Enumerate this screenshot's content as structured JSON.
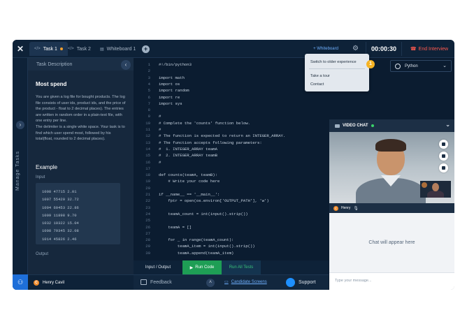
{
  "header": {
    "tabs": [
      {
        "label": "Task 1"
      },
      {
        "label": "Task 2"
      },
      {
        "label": "Whiteboard 1"
      }
    ],
    "whiteboard_label": "+ Whiteboard",
    "timer": "00:00:30",
    "end_label": "End Interview"
  },
  "sidebar": {
    "label": "Manage Tasks"
  },
  "task": {
    "header": "Task Description",
    "title": "Most spend",
    "body": "You are given a log file for bought products. The log file consists of user ids, product ids, and the price of the product - float to 2 decimal places). The entries are written in random order in a plain-text file, with one entry per line.\nThe delimiter is a single white space. Your task is to find which user spend most, followed by his total(float, rounded to 2 decimal places).",
    "example_title": "Example",
    "input_label": "Input",
    "input_lines": [
      "1008 47715 2.01",
      "1007 55420 32.72",
      "1004 60453 22.86",
      "1009 11898 9.70",
      "1032 10322 15.04",
      "1008 79345 32.08",
      "1014 45826 2.46"
    ],
    "output_label": "Output"
  },
  "candidate": {
    "initial": "C",
    "name": "Henry Cavil"
  },
  "editor": {
    "lines": [
      {
        "n": "1",
        "t": "#!/bin/python3"
      },
      {
        "n": "2",
        "t": ""
      },
      {
        "n": "3",
        "t": "import math"
      },
      {
        "n": "4",
        "t": "import os"
      },
      {
        "n": "5",
        "t": "import random"
      },
      {
        "n": "6",
        "t": "import re"
      },
      {
        "n": "7",
        "t": "import sys"
      },
      {
        "n": "8",
        "t": ""
      },
      {
        "n": "9",
        "t": "#"
      },
      {
        "n": "10",
        "t": "# Complete the 'counts' function below."
      },
      {
        "n": "11",
        "t": "#"
      },
      {
        "n": "12",
        "t": "# The function is expected to return an INTEGER_ARRAY."
      },
      {
        "n": "13",
        "t": "# The function accepts following parameters:"
      },
      {
        "n": "14",
        "t": "#  1. INTEGER_ARRAY teamA"
      },
      {
        "n": "15",
        "t": "#  2. INTEGER_ARRAY teamB"
      },
      {
        "n": "16",
        "t": "#"
      },
      {
        "n": "17",
        "t": ""
      },
      {
        "n": "18",
        "t": "def counts(teamA, teamB):"
      },
      {
        "n": "19",
        "t": "    # Write your code here"
      },
      {
        "n": "20",
        "t": ""
      },
      {
        "n": "21",
        "t": "if __name__ == '__main__':"
      },
      {
        "n": "22",
        "t": "    fptr = open(os.environ['OUTPUT_PATH'], 'w')"
      },
      {
        "n": "23",
        "t": ""
      },
      {
        "n": "24",
        "t": "    teamA_count = int(input().strip())"
      },
      {
        "n": "25",
        "t": ""
      },
      {
        "n": "26",
        "t": "    teamA = []"
      },
      {
        "n": "27",
        "t": ""
      },
      {
        "n": "28",
        "t": "    for _ in range(teamA_count):"
      },
      {
        "n": "29",
        "t": "        teamA_item = int(input().strip())"
      },
      {
        "n": "30",
        "t": "        teamA.append(teamA_item)"
      }
    ]
  },
  "language": {
    "selected": "Python"
  },
  "dropdown": {
    "switch": "Switch to older experience",
    "tour": "Take a tour",
    "contact": "Contact",
    "badge": "1"
  },
  "actions": {
    "io": "Input / Output",
    "run": "Run Code",
    "run_all": "Run All Tests"
  },
  "footer": {
    "feedback": "Feedback",
    "screens": "Candidate Screens",
    "support": "Support"
  },
  "video": {
    "title": "VIDEO CHAT",
    "user_initial": "C",
    "user_name": "Henry",
    "chat_placeholder": "Chat will appear here",
    "input_placeholder": "Type your message..."
  },
  "colors": {
    "accent_blue": "#1e6fd9",
    "run_green": "#1e9e55",
    "end_red": "#ff5a4f",
    "badge_yellow": "#f6b324"
  }
}
